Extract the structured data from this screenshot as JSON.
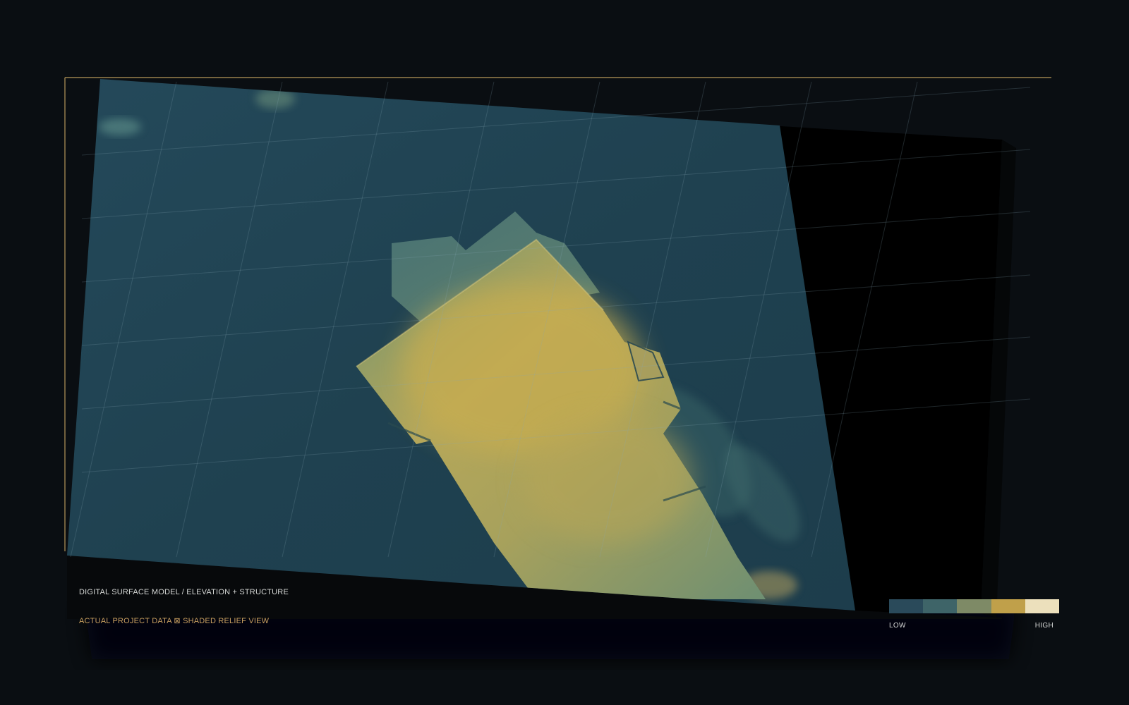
{
  "captions": {
    "title": "DIGITAL SURFACE MODEL  /  ELEVATION + STRUCTURE",
    "subtitle": "ACTUAL PROJECT DATA ⊠ SHADED RELIEF VIEW"
  },
  "legend": {
    "low_label": "LOW",
    "high_label": "HIGH",
    "colors": [
      "#2a4a5a",
      "#3e6468",
      "#7e8a66",
      "#c0a04a",
      "#ece0bc"
    ]
  },
  "palette": {
    "background": "#0a0e12",
    "terrain_low": "#1f4150",
    "terrain_high": "#c7ad52",
    "frame_accent": "#b8985a",
    "void": "#000000"
  }
}
